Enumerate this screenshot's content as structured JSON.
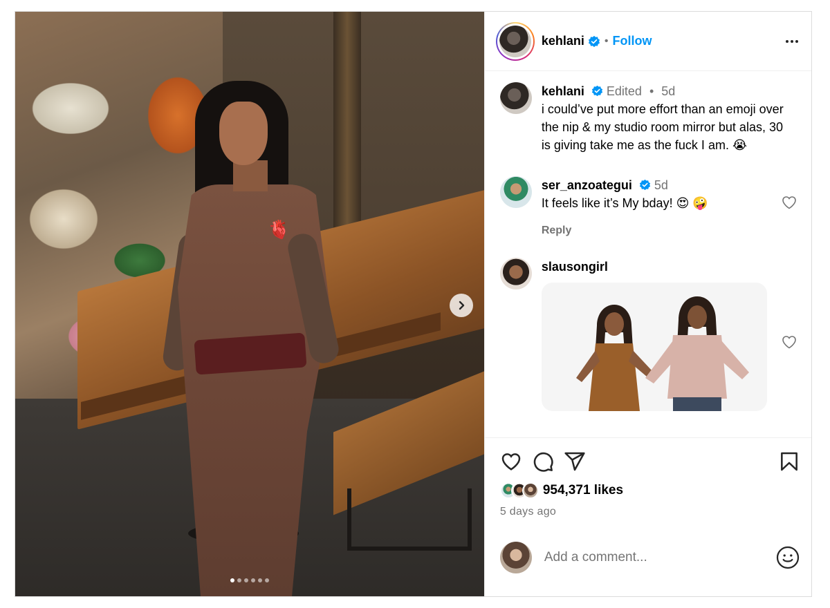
{
  "post": {
    "author": "kehlani",
    "follow_label": "Follow",
    "separator": "•"
  },
  "media": {
    "slides_total": 6,
    "active_slide": 1
  },
  "caption": {
    "user": "kehlani",
    "edited": "Edited",
    "dot": "•",
    "time": "5d",
    "text": "i could’ve put more effort than an emoji over the nip & my studio room mirror but alas, 30 is giving take me as the fuck I am. 😭"
  },
  "comments": [
    {
      "user": "ser_anzoategui",
      "time": "5d",
      "text": "It feels like it’s My bday! 😍 🤪",
      "reply_label": "Reply"
    },
    {
      "user": "slausongirl",
      "gif": true
    }
  ],
  "stats": {
    "likes": "954,371 likes",
    "time_ago": "5 days ago"
  },
  "composer": {
    "placeholder": "Add a comment..."
  },
  "colors": {
    "accent": "#0095f6",
    "verified": "#0095f6",
    "muted": "#737373",
    "border": "#dbdbdb"
  },
  "icons": {
    "like": "heart-icon",
    "comment": "comment-icon",
    "share": "send-icon",
    "save": "bookmark-icon",
    "more": "more-icon",
    "emoji": "emoji-icon",
    "next": "chevron-right-icon",
    "verified": "verified-badge-icon"
  }
}
